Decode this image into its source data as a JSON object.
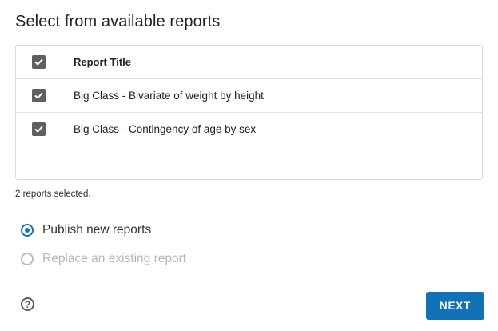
{
  "title": "Select from available reports",
  "table": {
    "header": "Report Title",
    "rows": [
      {
        "label": "Big Class - Bivariate of weight by height",
        "checked": true
      },
      {
        "label": "Big Class - Contingency of age by sex",
        "checked": true
      }
    ]
  },
  "selection_count": "2 reports selected.",
  "options": {
    "publish_new": {
      "label": "Publish new reports",
      "selected": true
    },
    "replace_existing": {
      "label": "Replace an existing report",
      "disabled": true
    }
  },
  "help_icon": "?",
  "next_label": "NEXT",
  "colors": {
    "accent": "#1172b7",
    "checkbox": "#5f5f5f"
  }
}
